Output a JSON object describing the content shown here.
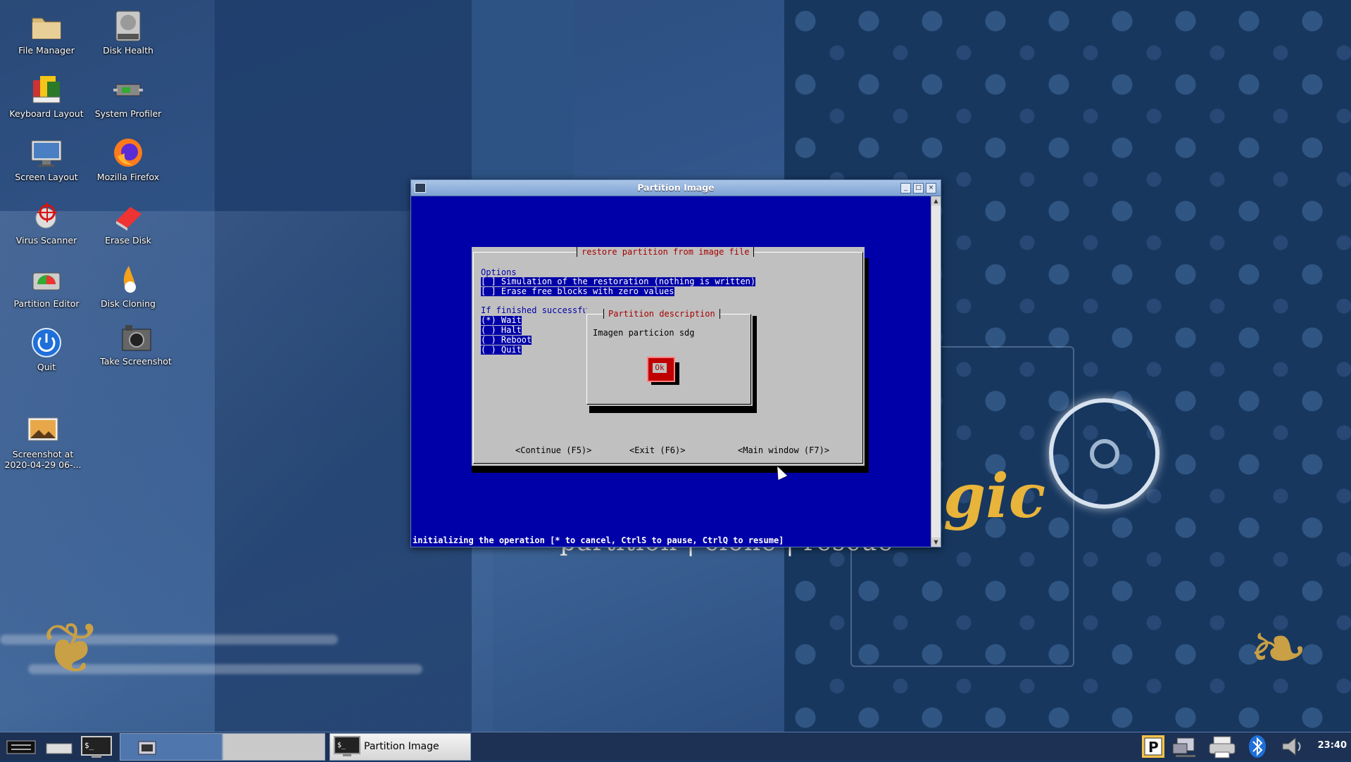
{
  "desktop": {
    "icons": [
      {
        "label": "File Manager",
        "icon": "folder-icon"
      },
      {
        "label": "Disk Health",
        "icon": "hard-disk-icon"
      },
      {
        "label": "Keyboard Layout",
        "icon": "keyboard-flags-icon"
      },
      {
        "label": "System Profiler",
        "icon": "chip-icon"
      },
      {
        "label": "Screen Layout",
        "icon": "monitor-icon"
      },
      {
        "label": "Mozilla Firefox",
        "icon": "firefox-icon"
      },
      {
        "label": "Virus Scanner",
        "icon": "crosshair-icon"
      },
      {
        "label": "Erase Disk",
        "icon": "eraser-icon"
      },
      {
        "label": "Partition Editor",
        "icon": "disk-partition-icon"
      },
      {
        "label": "Disk Cloning",
        "icon": "sheep-icon"
      },
      {
        "label": "Quit",
        "icon": "power-icon"
      },
      {
        "label": "Take Screenshot",
        "icon": "camera-icon"
      },
      {
        "label": "Screenshot at\n2020-04-29 06-...",
        "icon": "image-file-icon"
      }
    ],
    "wallpaper_tagline": "partition | clone | rescue",
    "wallpaper_logo_text": "gic"
  },
  "window": {
    "title": "Partition Image",
    "terminal": {
      "dialog_title": "restore partition from image file",
      "options_heading": "Options",
      "options": [
        "[ ] Simulation of the restoration (nothing is written)",
        "[ ] Erase free blocks with zero values"
      ],
      "finished_heading": "If finished successfu",
      "finished_choices": [
        "(*) Wait",
        "( ) Halt",
        "( ) Reboot",
        "( ) Quit"
      ],
      "buttons": [
        "<Continue (F5)>",
        "<Exit (F6)>",
        "<Main window (F7)>"
      ],
      "popup": {
        "title": "Partition description",
        "text": "Imagen particion sdg",
        "ok_label": "Ok"
      },
      "status": "initializing the operation [* to cancel, CtrlS to pause, CtrlQ to resume]"
    }
  },
  "taskbar": {
    "active_task": "Partition Image",
    "clock": "23:40"
  },
  "colors": {
    "terminal_bg": "#0000a8",
    "dialog_bg": "#c0c0c0",
    "dialog_title": "#a80000",
    "titlebar": "#7ea3d4",
    "taskbar": "#1c3154"
  }
}
